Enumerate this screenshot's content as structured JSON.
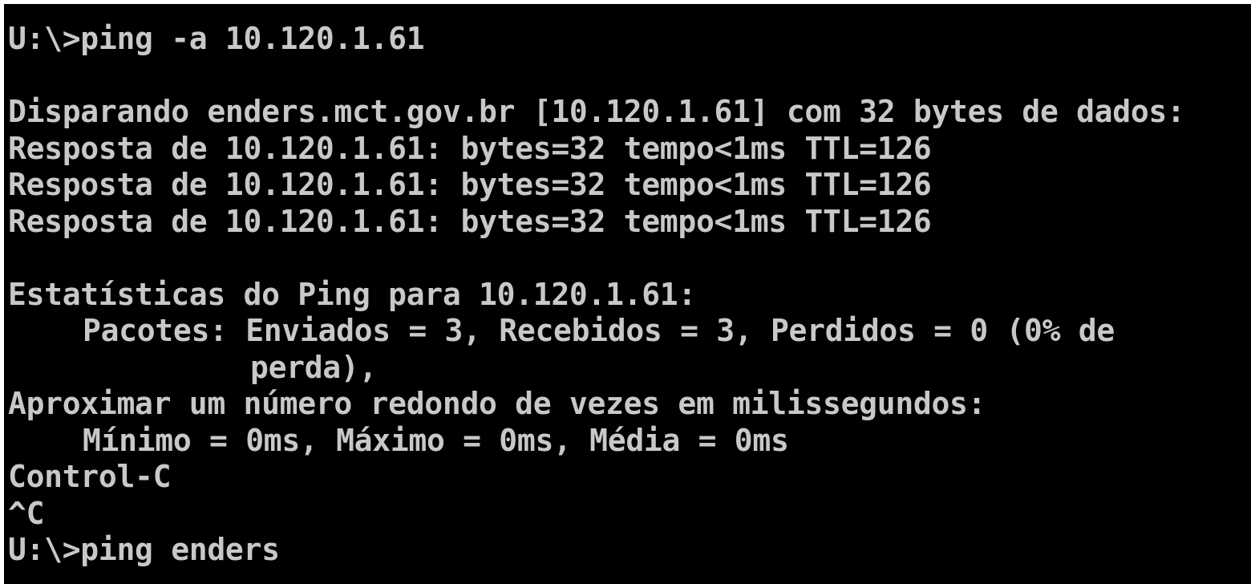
{
  "console": {
    "cutoff_line": "U:\\>",
    "lines": [
      {
        "text": "U:\\>ping -a 10.120.1.61",
        "indent": 0
      },
      {
        "text": "",
        "indent": 0
      },
      {
        "text": "Disparando enders.mct.gov.br [10.120.1.61] com 32 bytes de dados:",
        "indent": 0
      },
      {
        "text": "Resposta de 10.120.1.61: bytes=32 tempo<1ms TTL=126",
        "indent": 0
      },
      {
        "text": "Resposta de 10.120.1.61: bytes=32 tempo<1ms TTL=126",
        "indent": 0
      },
      {
        "text": "Resposta de 10.120.1.61: bytes=32 tempo<1ms TTL=126",
        "indent": 0
      },
      {
        "text": "",
        "indent": 0
      },
      {
        "text": "Estatísticas do Ping para 10.120.1.61:",
        "indent": 0
      },
      {
        "text": "Pacotes: Enviados = 3, Recebidos = 3, Perdidos = 0 (0% de",
        "indent": 1
      },
      {
        "text": "perda),",
        "indent": 2
      },
      {
        "text": "Aproximar um número redondo de vezes em milissegundos:",
        "indent": 0
      },
      {
        "text": "Mínimo = 0ms, Máximo = 0ms, Média = 0ms",
        "indent": 1
      },
      {
        "text": "Control-C",
        "indent": 0
      },
      {
        "text": "^C",
        "indent": 0
      },
      {
        "text": "U:\\>ping enders",
        "indent": 0
      }
    ]
  },
  "colors": {
    "background": "#000000",
    "foreground": "#c8c8c8"
  }
}
